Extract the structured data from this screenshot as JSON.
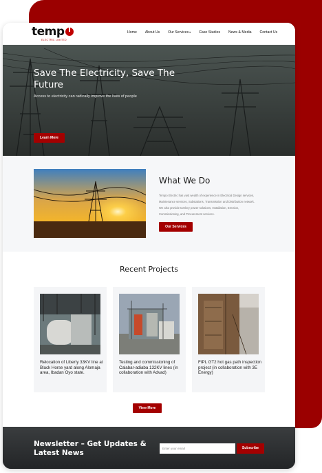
{
  "logo": {
    "text_main": "temp",
    "tagline": "ELECTRIC LIMITED"
  },
  "nav": {
    "items": [
      "Home",
      "About Us",
      "Our Services",
      "Case Studies",
      "News & Media",
      "Contact Us"
    ]
  },
  "hero": {
    "title": "Save The Electricity, Save The Future",
    "subtitle": "Access to electricity can radically improve the lives of people",
    "button": "Learn More"
  },
  "what_we_do": {
    "title": "What We Do",
    "text": "Tempo Electric has vast wealth of experience in Electrical Design services, Maintenance services, Substations, Transmission and Distribution network. We also provide turnkey power solutions, Installation, Erection, Commissioning, and Procurement services.",
    "button": "Our Services"
  },
  "projects": {
    "title": "Recent Projects",
    "items": [
      {
        "caption": "Relocation of Liberty 33KV line at Black Horse yard along Alomaja area, Ibadan Oyo state."
      },
      {
        "caption": "Testing and commissioning of Calabar-adiaba 132KV lines (in collaboration with Advad)"
      },
      {
        "caption": "FIPL GT2 hot gas path inspection project (in collaboration with 3E Energy)"
      }
    ],
    "button": "View More"
  },
  "newsletter": {
    "title": "Newsletter – Get Updates & Latest News",
    "placeholder": "Enter your email",
    "button": "Subscribe"
  },
  "colors": {
    "accent": "#a40000",
    "backdrop": "#9b0000",
    "dark": "#2a2d2f"
  }
}
